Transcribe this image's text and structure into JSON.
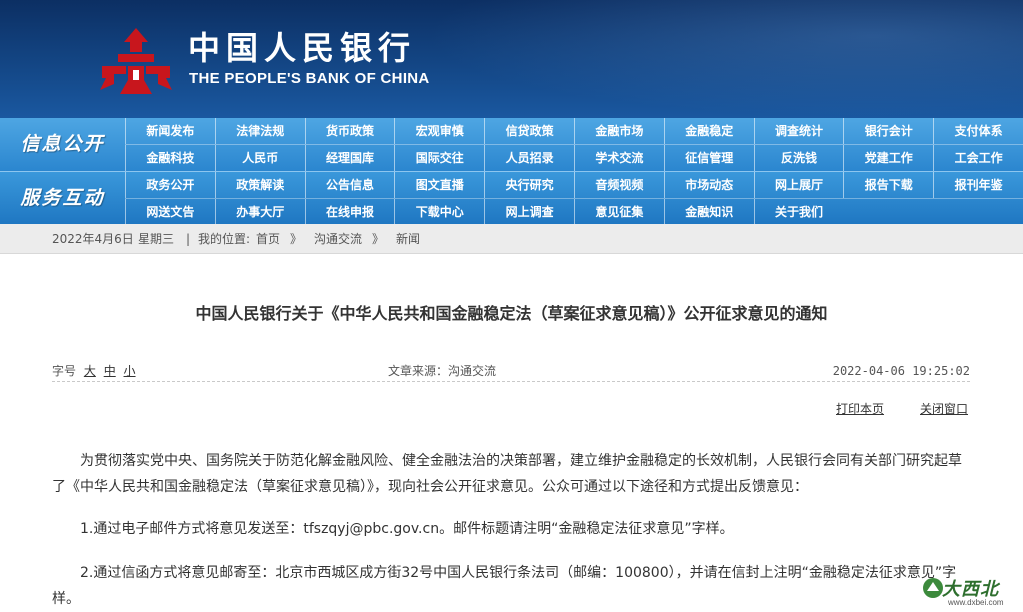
{
  "header": {
    "logo_cn": "中国人民银行",
    "logo_en": "THE PEOPLE'S BANK OF CHINA",
    "brand_color": "#c8161d"
  },
  "nav": {
    "section1_label": "信息公开",
    "section2_label": "服务互动",
    "section1_items": [
      [
        "新闻发布",
        "法律法规",
        "货币政策",
        "宏观审慎",
        "信贷政策",
        "金融市场",
        "金融稳定",
        "调查统计",
        "银行会计",
        "支付体系"
      ],
      [
        "金融科技",
        "人民币",
        "经理国库",
        "国际交往",
        "人员招录",
        "学术交流",
        "征信管理",
        "反洗钱",
        "党建工作",
        "工会工作"
      ]
    ],
    "section2_items": [
      [
        "政务公开",
        "政策解读",
        "公告信息",
        "图文直播",
        "央行研究",
        "音频视频",
        "市场动态",
        "网上展厅",
        "报告下载",
        "报刊年鉴"
      ],
      [
        "网送文告",
        "办事大厅",
        "在线申报",
        "下载中心",
        "网上调查",
        "意见征集",
        "金融知识",
        "关于我们"
      ]
    ]
  },
  "breadcrumb": {
    "date": "2022年4月6日",
    "weekday": "星期三",
    "sep": "|",
    "location_prefix": "我的位置:",
    "home": "首页",
    "arrow1": "》",
    "level1": "沟通交流",
    "arrow2": "》",
    "level2": "新闻"
  },
  "article": {
    "title": "中国人民银行关于《中华人民共和国金融稳定法（草案征求意见稿）》公开征求意见的通知",
    "font_size_label": "字号",
    "font_large": "大",
    "font_medium": "中",
    "font_small": "小",
    "source": "文章来源：沟通交流",
    "datetime": "2022-04-06 19:25:02",
    "print_label": "打印本页",
    "close_label": "关闭窗口",
    "paragraphs": [
      "为贯彻落实党中央、国务院关于防范化解金融风险、健全金融法治的决策部署，建立维护金融稳定的长效机制，人民银行会同有关部门研究起草了《中华人民共和国金融稳定法（草案征求意见稿）》，现向社会公开征求意见。公众可通过以下途径和方式提出反馈意见：",
      "1.通过电子邮件方式将意见发送至：tfszqyj@pbc.gov.cn。邮件标题请注明“金融稳定法征求意见”字样。",
      "2.通过信函方式将意见邮寄至：北京市西城区成方街32号中国人民银行条法司（邮编：100800），并请在信封上注明“金融稳定法征求意见”字样。"
    ]
  },
  "watermark": {
    "cn": "大西北",
    "url": "www.dxbei.com"
  }
}
